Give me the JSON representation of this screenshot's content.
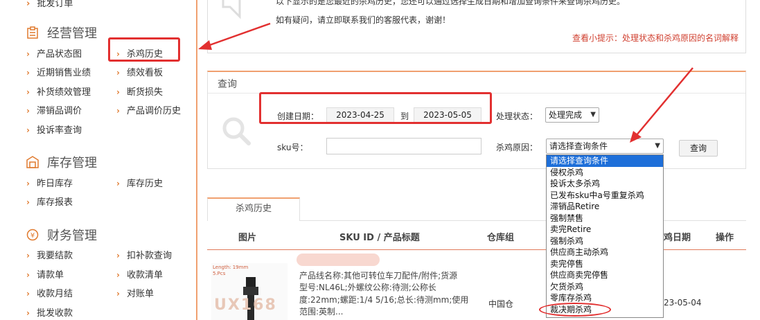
{
  "sidebar": {
    "top_partial": "批发订单",
    "sections": [
      {
        "title": "经营管理",
        "items": [
          "产品状态图",
          "杀鸡历史",
          "近期销售业绩",
          "绩效看板",
          "补货绩效管理",
          "断货损失",
          "滞销品调价",
          "产品调价历史",
          "投诉率查询"
        ]
      },
      {
        "title": "库存管理",
        "items": [
          "昨日库存",
          "库存历史",
          "库存报表"
        ]
      },
      {
        "title": "财务管理",
        "items": [
          "我要结款",
          "扣补款查询",
          "请款单",
          "收款清单",
          "收款月结",
          "对账单",
          "批发收款"
        ]
      }
    ]
  },
  "notice": {
    "line1": "以下显示的是您最近的杀鸡历史，您还可以通过选择生成日期和增加查询条件来查询杀鸡历史。",
    "line2": "如有疑问，请立即联系我们的客服代表，谢谢！",
    "hint": "查看小提示：处理状态和杀鸡原因的名词解释"
  },
  "query": {
    "title": "查询",
    "created_date_label": "创建日期：",
    "date_from": "2023-04-25",
    "to_label": "到",
    "date_to": "2023-05-05",
    "status_label": "处理状态：",
    "status_value": "处理完成",
    "sku_label": "sku号：",
    "sku_value": "",
    "reason_label": "杀鸡原因：",
    "reason_value": "请选择查询条件",
    "button": "查询"
  },
  "dropdown": {
    "options": [
      "请选择查询条件",
      "侵权杀鸡",
      "投诉太多杀鸡",
      "已发布sku中a号重复杀鸡",
      "滞销品Retire",
      "强制禁售",
      "卖完Retire",
      "强制杀鸡",
      "供应商主动杀鸡",
      "卖完停售",
      "供应商卖完停售",
      "欠货杀鸡",
      "零库存杀鸡",
      "裁决期杀鸡"
    ],
    "selected_index": 0
  },
  "history": {
    "tab": "杀鸡历史",
    "columns": [
      "图片",
      "SKU ID / 产品标题",
      "仓库组",
      "鸡日期",
      "操作"
    ],
    "row": {
      "img_label_1": "Length: 19mm",
      "img_label_2": "5.Pcs",
      "img_watermark": "UX168",
      "desc": [
        "产品线名称:其他可转位车刀配件/附件;货源",
        "型号:NL46L;外螺纹公称:待测;公称长",
        "度:22mm;螺距:1/4 5/16;总长:待测mm;使用",
        "范围:英制..."
      ],
      "warehouse": "中国仓",
      "date": "23-05-04"
    }
  },
  "colors": {
    "accent": "#e07a2e",
    "highlight_red": "#e23030",
    "dropdown_selected": "#1e6fd9"
  }
}
